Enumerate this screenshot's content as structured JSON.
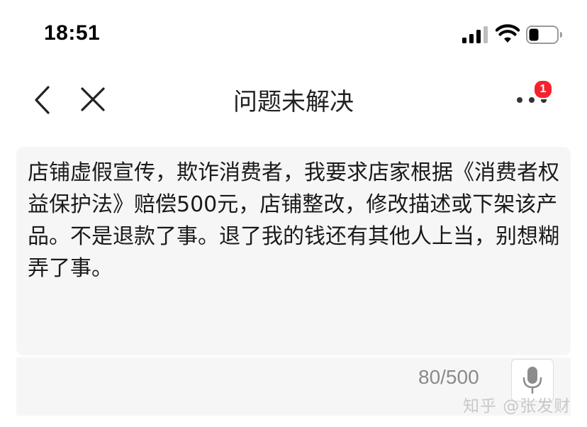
{
  "status_bar": {
    "time": "18:51",
    "icons": [
      "signal-icon",
      "wifi-icon",
      "battery-icon"
    ]
  },
  "nav": {
    "title": "问题未解决",
    "back_icon": "back-chevron-icon",
    "close_icon": "close-icon",
    "more_icon": "more-dots-icon",
    "badge_count": "1"
  },
  "editor": {
    "text": "店铺虚假宣传，欺诈消费者，我要求店家根据《消费者权益保护法》赔偿500元，店铺整改，修改描述或下架该产品。不是退款了事。退了我的钱还有其他人上当，别想糊弄了事。",
    "counter": "80/500",
    "mic_icon": "microphone-icon"
  },
  "watermark": "知乎 @张发财",
  "colors": {
    "badge": "#f5222d",
    "card_bg": "#f6f6f6",
    "counter": "#8a8a8a"
  }
}
